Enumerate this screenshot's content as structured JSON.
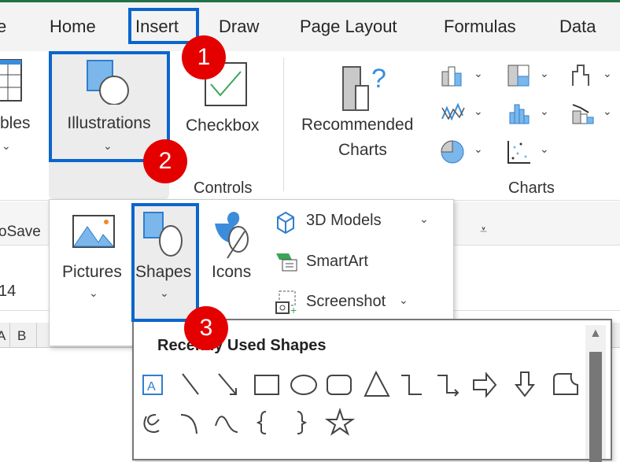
{
  "tabs": [
    "e",
    "Home",
    "Insert",
    "Draw",
    "Page Layout",
    "Formulas",
    "Data"
  ],
  "ribbon": {
    "tables_label": "bles",
    "illustrations_label": "Illustrations",
    "checkbox_label": "Checkbox",
    "controls_group": "Controls",
    "recommended_charts_line1": "Recommended",
    "recommended_charts_line2": "Charts",
    "charts_group": "Charts"
  },
  "toolbar": {
    "autosave": "oSave"
  },
  "formula": {
    "cell_ref": "14"
  },
  "columns": [
    "A",
    "B"
  ],
  "illustrations_menu": {
    "pictures": "Pictures",
    "shapes": "Shapes",
    "icons": "Icons",
    "models_3d": "3D Models",
    "smartart": "SmartArt",
    "screenshot": "Screenshot"
  },
  "gallery": {
    "heading": "Recently Used Shapes"
  },
  "badges": [
    "1",
    "2",
    "3"
  ],
  "colors": {
    "accent": "#0a66cc",
    "badge": "#e50000",
    "excel_green": "#217346"
  }
}
